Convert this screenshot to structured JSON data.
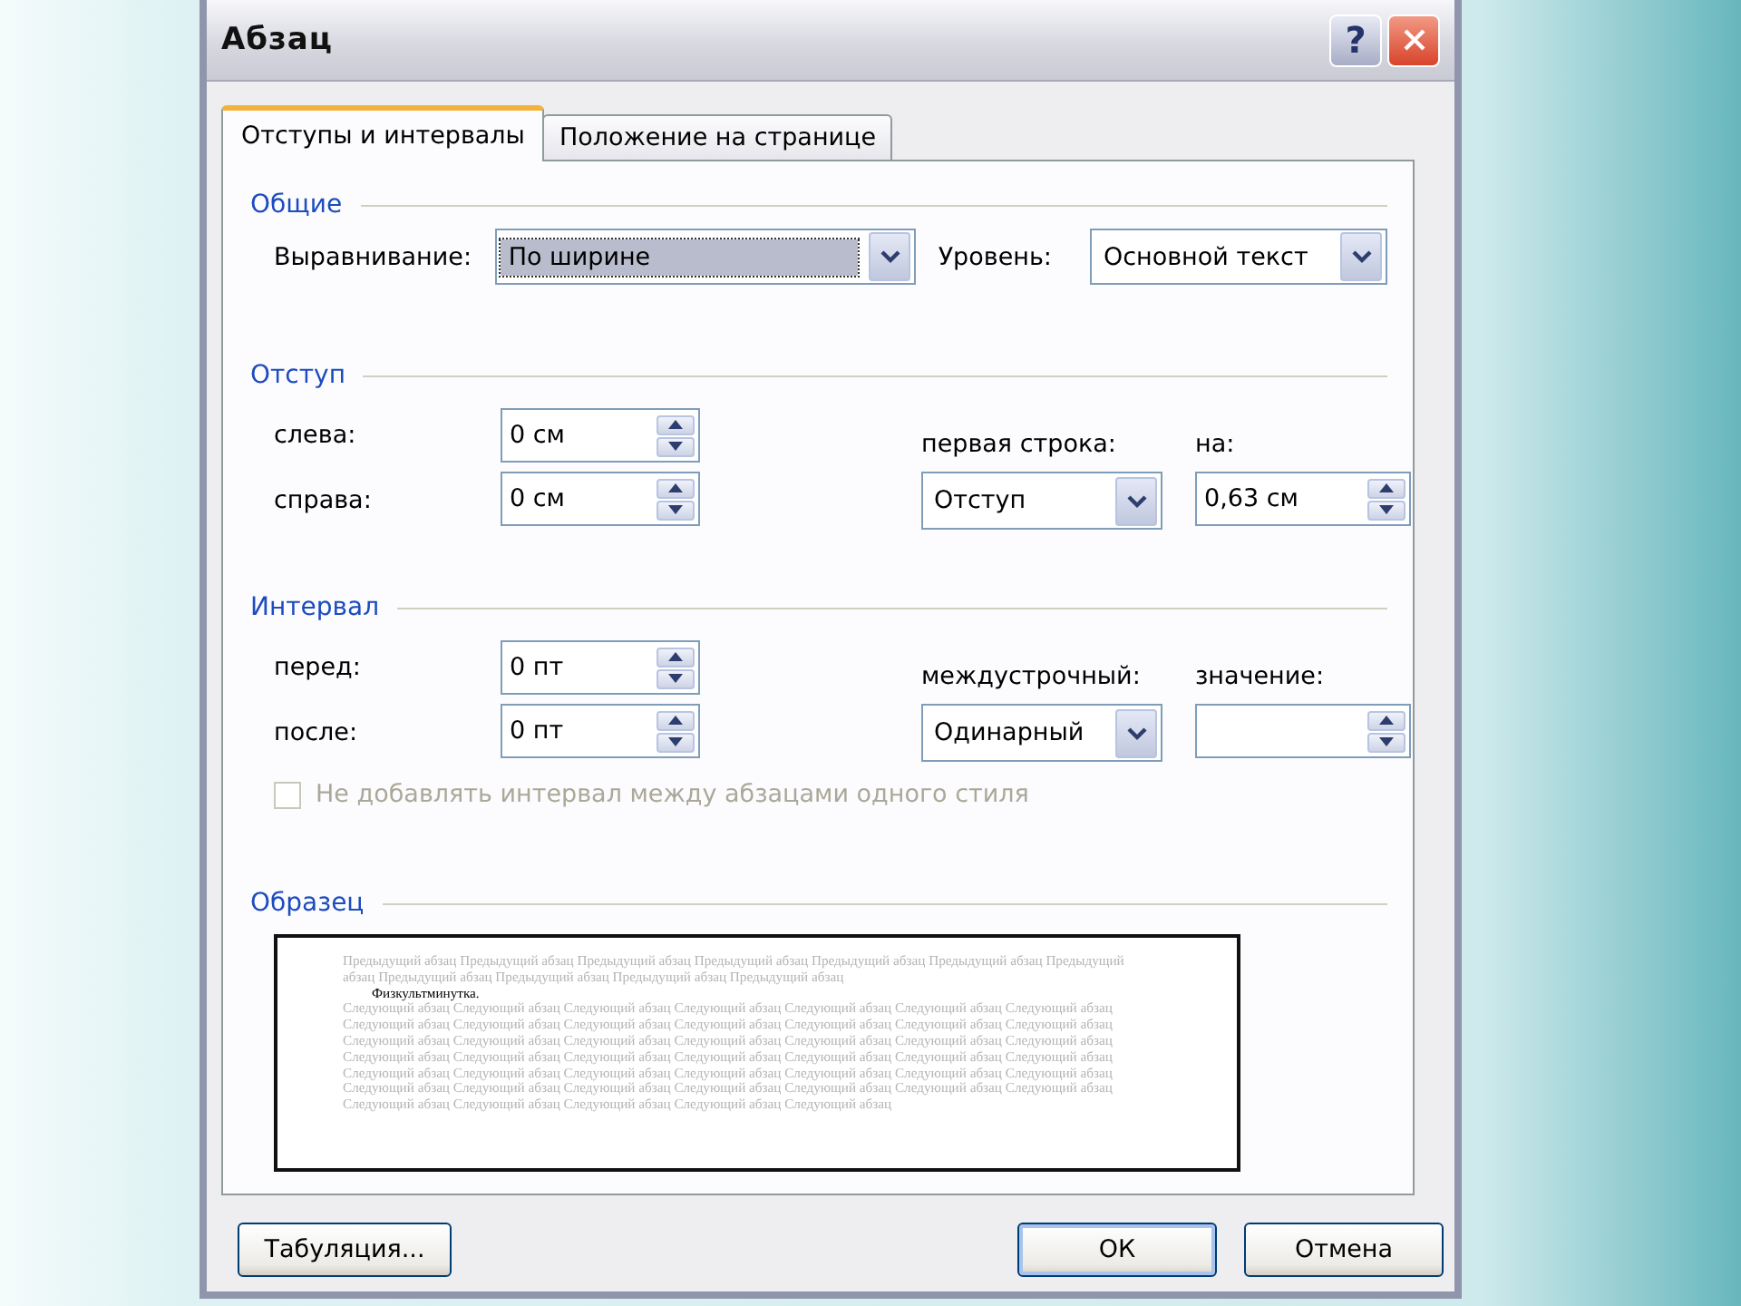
{
  "window": {
    "title": "Абзац",
    "help": "?"
  },
  "tabs": [
    {
      "label": "Отступы и интервалы",
      "selected": true
    },
    {
      "label": "Положение на странице",
      "selected": false
    }
  ],
  "general": {
    "title": "Общие",
    "alignment": {
      "label": "Выравнивание:",
      "value": "По ширине",
      "focused": true
    },
    "level": {
      "label": "Уровень:",
      "value": "Основной текст",
      "focused": false
    }
  },
  "indent": {
    "title": "Отступ",
    "left": {
      "label": "слева:",
      "value": "0 см"
    },
    "right": {
      "label": "справа:",
      "value": "0 см"
    },
    "first_line": {
      "label": "первая строка:",
      "value": "Отступ",
      "focused": false
    },
    "by": {
      "label": "на:",
      "value": "0,63 см"
    }
  },
  "spacing": {
    "title": "Интервал",
    "before": {
      "label": "перед:",
      "value": "0 пт"
    },
    "after": {
      "label": "после:",
      "value": "0 пт"
    },
    "line_spacing": {
      "label": "междустрочный:",
      "value": "Одинарный",
      "focused": false
    },
    "at": {
      "label": "значение:"
    },
    "no_space_same_style": {
      "label": "Не добавлять интервал между абзацами одного стиля",
      "checked": false,
      "disabled": true
    }
  },
  "preview": {
    "title": "Образец",
    "previous": "Предыдущий абзац Предыдущий абзац Предыдущий абзац Предыдущий абзац Предыдущий абзац Предыдущий абзац Предыдущий абзац Предыдущий абзац Предыдущий абзац Предыдущий абзац Предыдущий абзац",
    "sample": "Физкультминутка.",
    "next": "Следующий абзац Следующий абзац Следующий абзац Следующий абзац Следующий абзац Следующий абзац Следующий абзац Следующий абзац Следующий абзац Следующий абзац Следующий абзац Следующий абзац Следующий абзац Следующий абзац Следующий абзац Следующий абзац Следующий абзац Следующий абзац Следующий абзац Следующий абзац Следующий абзац Следующий абзац Следующий абзац Следующий абзац Следующий абзац Следующий абзац Следующий абзац Следующий абзац Следующий абзац Следующий абзац Следующий абзац Следующий абзац Следующий абзац Следующий абзац Следующий абзац Следующий абзац Следующий абзац Следующий абзац Следующий абзац Следующий абзац Следующий абзац Следующий абзац Следующий абзац Следующий абзац Следующий абзац Следующий абзац Следующий абзац"
  },
  "buttons": [
    {
      "label": "Табуляция...",
      "default": false,
      "kind": "left"
    },
    {
      "label": "ОК",
      "default": true,
      "kind": "right"
    },
    {
      "label": "Отмена",
      "default": false,
      "kind": "right"
    }
  ]
}
